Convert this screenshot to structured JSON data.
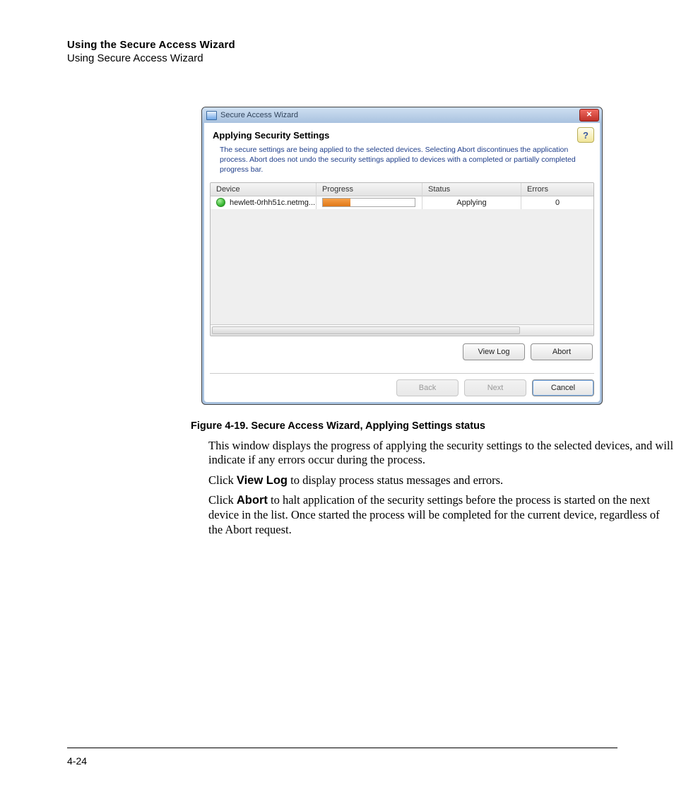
{
  "header": {
    "bold": "Using the Secure Access Wizard",
    "sub": "Using Secure Access Wizard"
  },
  "dialog": {
    "title": "Secure Access Wizard",
    "heading": "Applying Security Settings",
    "help_glyph": "?",
    "close_glyph": "✕",
    "description": "The secure settings are being applied to the selected devices. Selecting Abort discontinues the application process. Abort does not undo the security settings applied to devices with a completed or partially completed progress bar.",
    "columns": {
      "device": "Device",
      "progress": "Progress",
      "status": "Status",
      "errors": "Errors"
    },
    "rows": [
      {
        "device": "hewlett-0rhh51c.netmg...",
        "status": "Applying",
        "errors": "0"
      }
    ],
    "buttons": {
      "view_log": "View Log",
      "abort": "Abort",
      "back": "Back",
      "next": "Next",
      "cancel": "Cancel"
    }
  },
  "figure_caption": "Figure 4-19. Secure Access Wizard, Applying Settings status",
  "body": {
    "p1": "This window displays the progress of applying the security settings to the selected devices, and will indicate if any errors occur during the process.",
    "p2_pre": "Click ",
    "p2_bold": "View Log",
    "p2_post": " to display process status messages and errors.",
    "p3_pre": "Click ",
    "p3_bold": "Abort",
    "p3_post": " to halt application of the security settings before the process is started on the next device in the list. Once started the process will be completed for the current device, regardless of the Abort request."
  },
  "page_number": "4-24"
}
